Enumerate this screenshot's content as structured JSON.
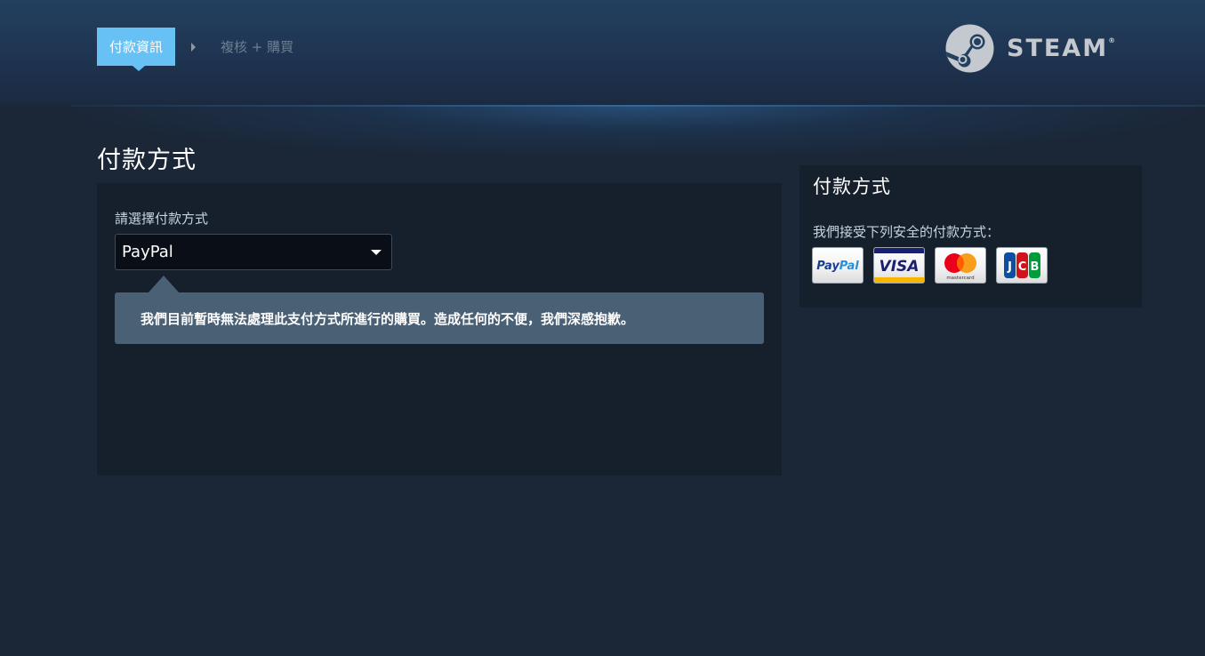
{
  "breadcrumb": {
    "steps": [
      {
        "label": "付款資訊",
        "active": true
      },
      {
        "label": "複核 + 購買",
        "active": false
      }
    ]
  },
  "brand": {
    "name": "STEAM",
    "mark": "®",
    "accent_color": "#67c1f5"
  },
  "main": {
    "title": "付款方式",
    "select_label": "請選擇付款方式",
    "select_value": "PayPal",
    "notice": "我們目前暫時無法處理此支付方式所進行的購買。造成任何的不便，我們深感抱歉。"
  },
  "side": {
    "title": "付款方式",
    "description": "我們接受下列安全的付款方式：",
    "cards": [
      {
        "name": "PayPal",
        "icon": "paypal-icon",
        "text": "PayPal"
      },
      {
        "name": "VISA",
        "icon": "visa-icon",
        "text": "VISA"
      },
      {
        "name": "mastercard",
        "icon": "mastercard-icon",
        "text": "mastercard"
      },
      {
        "name": "JCB",
        "icon": "jcb-icon",
        "text": "JCB"
      }
    ]
  }
}
